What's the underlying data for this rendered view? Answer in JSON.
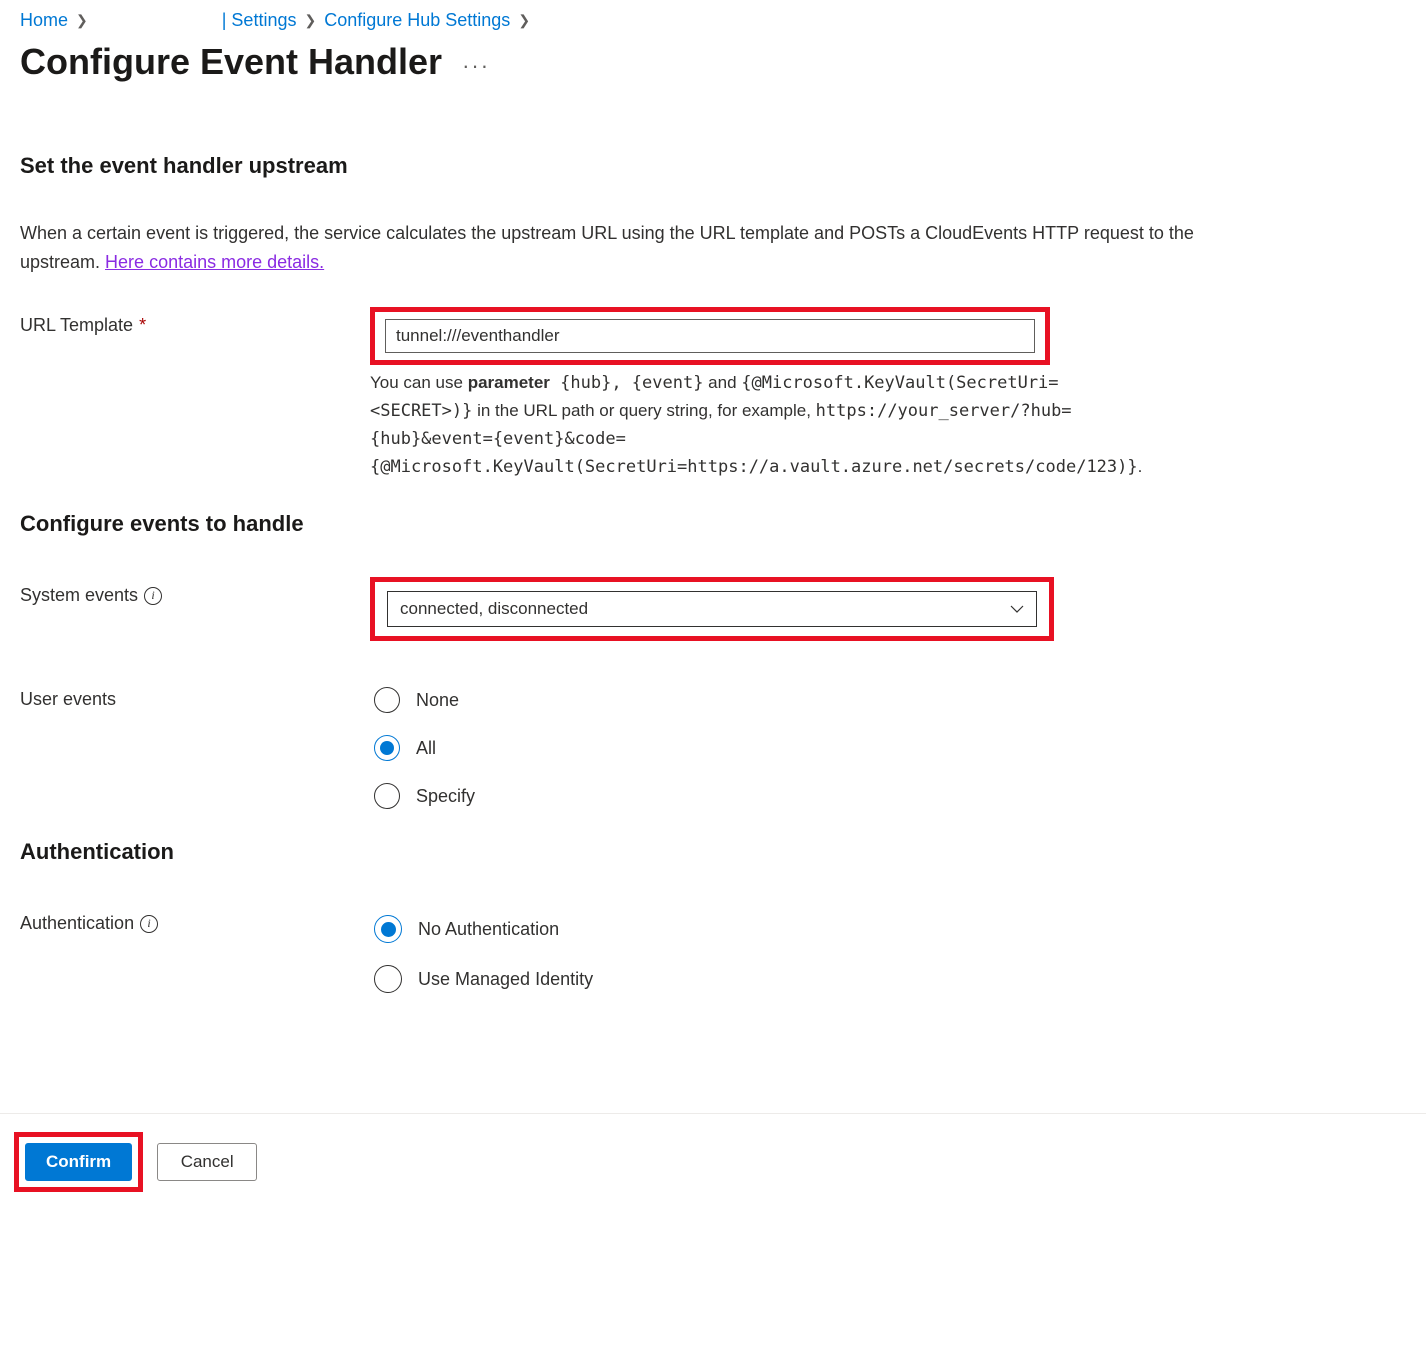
{
  "breadcrumb": {
    "home": "Home",
    "settings": "| Settings",
    "configure_hub": "Configure Hub Settings"
  },
  "page_title": "Configure Event Handler",
  "sections": {
    "upstream_head": "Set the event handler upstream",
    "events_head": "Configure events to handle",
    "auth_head": "Authentication"
  },
  "upstream": {
    "desc_part1": "When a certain event is triggered, the service calculates the upstream URL using the URL template and POSTs a CloudEvents HTTP request to the upstream. ",
    "desc_link": "Here contains more details."
  },
  "url_template": {
    "label": "URL Template",
    "value": "tunnel:///eventhandler",
    "help1a": "You can use ",
    "help1b": "parameter",
    "help1c": " {hub}, {event}",
    "help1d": " and ",
    "help1e": "{@Microsoft.KeyVault(SecretUri=<SECRET>)}",
    "help1f": " in the URL path or query string, for example, ",
    "help1g": "https://your_server/?hub={hub}&event={event}&code={@Microsoft.KeyVault(SecretUri=https://a.vault.azure.net/secrets/code/123)}",
    "help1h": "."
  },
  "system_events": {
    "label": "System events",
    "value": "connected, disconnected"
  },
  "user_events": {
    "label": "User events",
    "options": {
      "none": "None",
      "all": "All",
      "specify": "Specify"
    }
  },
  "auth": {
    "label": "Authentication",
    "options": {
      "none": "No Authentication",
      "managed": "Use Managed Identity"
    }
  },
  "footer": {
    "confirm": "Confirm",
    "cancel": "Cancel"
  }
}
